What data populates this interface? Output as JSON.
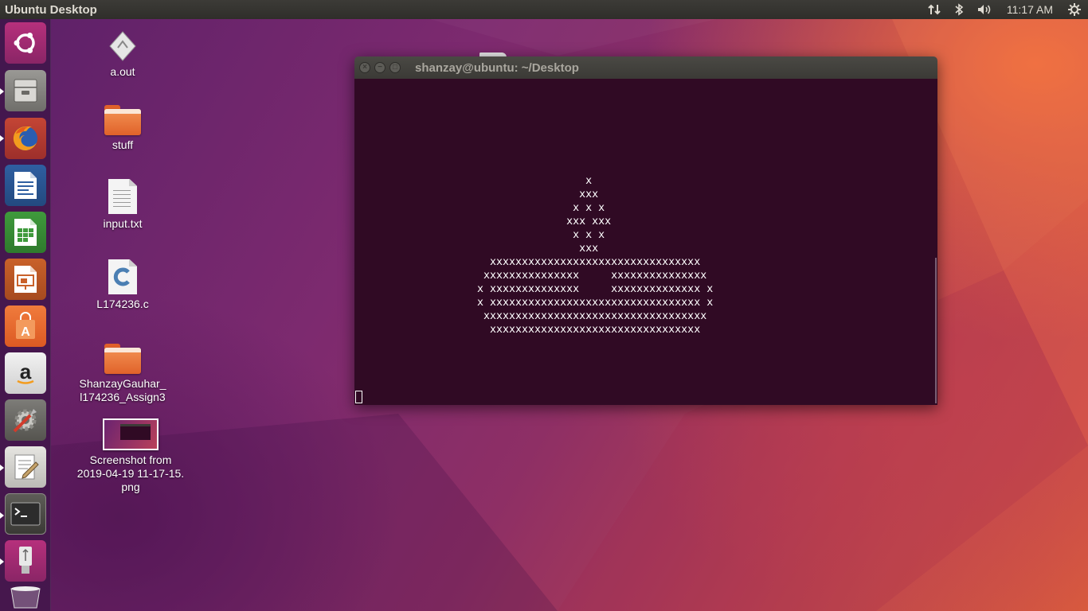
{
  "top_panel": {
    "title": "Ubuntu Desktop",
    "clock": "11:17 AM",
    "icons": [
      "network-icon",
      "bluetooth-icon",
      "volume-icon",
      "settings-gear-icon"
    ]
  },
  "launcher": {
    "items": [
      {
        "name": "ubuntu-dash",
        "icon": "ubuntu-logo-icon"
      },
      {
        "name": "files",
        "icon": "file-cabinet-icon"
      },
      {
        "name": "firefox",
        "icon": "firefox-icon"
      },
      {
        "name": "libreoffice-writer",
        "icon": "writer-icon"
      },
      {
        "name": "libreoffice-calc",
        "icon": "calc-icon"
      },
      {
        "name": "libreoffice-impress",
        "icon": "impress-icon"
      },
      {
        "name": "software-center",
        "icon": "shopping-bag-icon"
      },
      {
        "name": "amazon",
        "icon": "amazon-icon"
      },
      {
        "name": "system-settings",
        "icon": "settings-tools-icon"
      },
      {
        "name": "text-editor",
        "icon": "text-editor-icon"
      },
      {
        "name": "terminal",
        "icon": "terminal-icon"
      },
      {
        "name": "usb-drive",
        "icon": "usb-icon"
      },
      {
        "name": "trash",
        "icon": "trash-icon"
      }
    ]
  },
  "desktop_icons": [
    {
      "label": "a.out",
      "type": "executable"
    },
    {
      "label": "stuff",
      "type": "folder"
    },
    {
      "label": "input.txt",
      "type": "text"
    },
    {
      "label": "L174236.c",
      "type": "c-source"
    },
    {
      "label": "ShanzayGauhar_\nl174236_Assign3",
      "type": "folder"
    },
    {
      "label": "Screenshot from\n2019-04-19 11-17-15.\npng",
      "type": "image"
    }
  ],
  "terminal": {
    "title": "shanzay@ubuntu: ~/Desktop",
    "output": "                  x\n                 xxx\n                x x x\n               xxx xxx\n                x x x\n                 xxx\n   xxxxxxxxxxxxxxxxxxxxxxxxxxxxxxxxx\n  xxxxxxxxxxxxxxx     xxxxxxxxxxxxxxx\n x xxxxxxxxxxxxxx     xxxxxxxxxxxxxx x\n x xxxxxxxxxxxxxxxxxxxxxxxxxxxxxxxxx x\n  xxxxxxxxxxxxxxxxxxxxxxxxxxxxxxxxxxx\n   xxxxxxxxxxxxxxxxxxxxxxxxxxxxxxxxx"
  }
}
